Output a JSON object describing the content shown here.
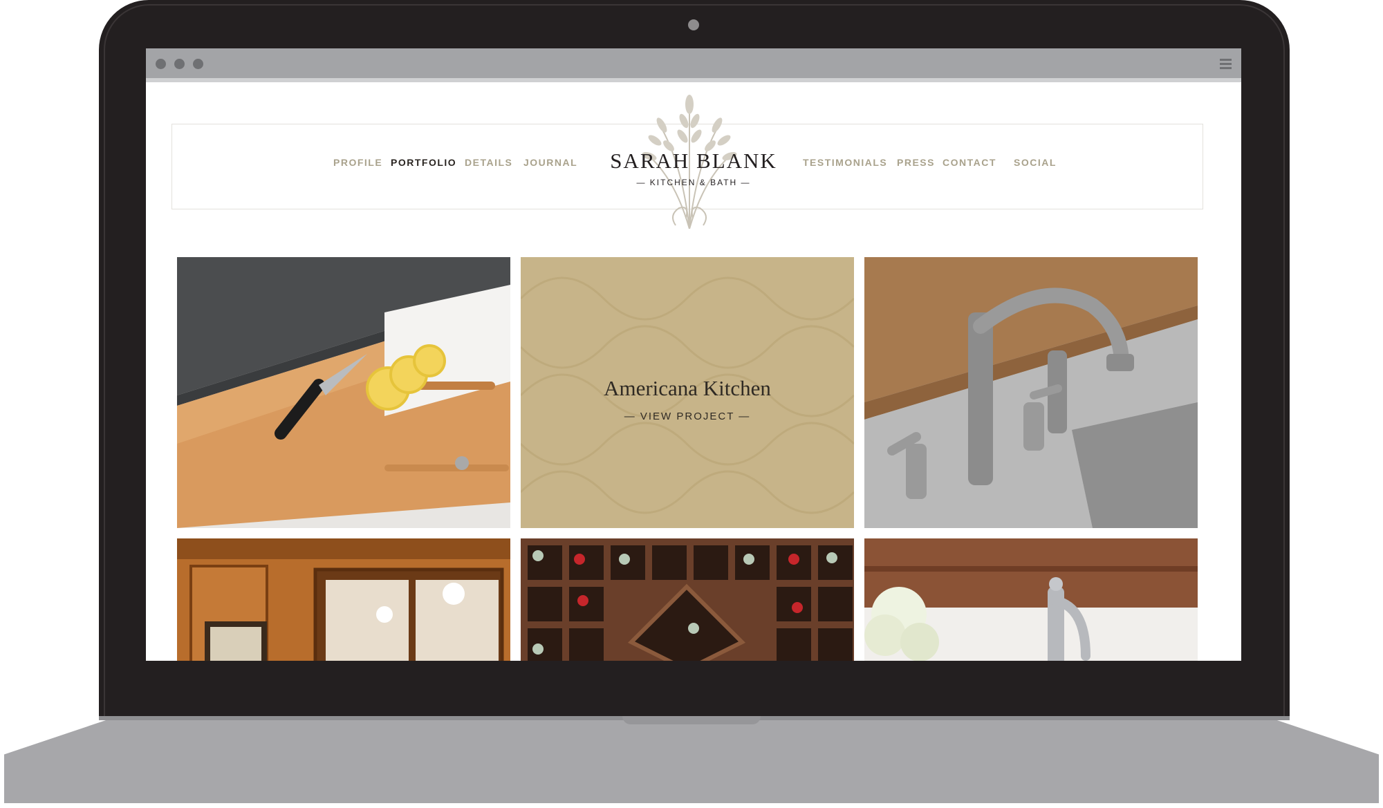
{
  "site": {
    "brand_name": "SARAH BLANK",
    "brand_sub": "— KITCHEN & BATH —"
  },
  "nav": {
    "left": [
      "PROFILE",
      "PORTFOLIO",
      "DETAILS",
      "JOURNAL"
    ],
    "right": [
      "TESTIMONIALS",
      "PRESS",
      "CONTACT",
      "SOCIAL"
    ],
    "active": "PORTFOLIO"
  },
  "featured_project": {
    "title": "Americana Kitchen",
    "cta": "— VIEW PROJECT —"
  },
  "colors": {
    "nav_text": "#a9a28c",
    "nav_active": "#2a2521",
    "feature_tile": "#c7b489",
    "laptop_frame": "#231f20"
  },
  "icons": {
    "logo": "wheat-sheaf-icon",
    "browser_menu": "hamburger-icon"
  }
}
